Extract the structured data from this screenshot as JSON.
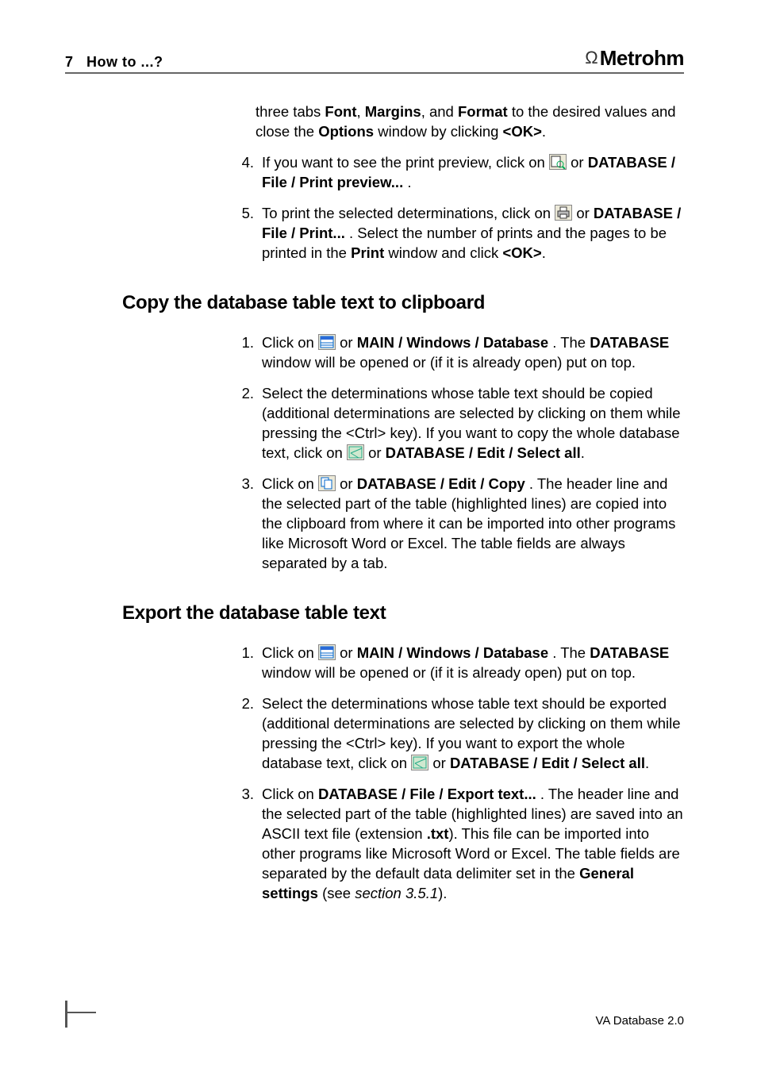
{
  "header": {
    "chapter_num": "7",
    "chapter_title": "How to ...?",
    "brand": "Metrohm"
  },
  "footer": {
    "product": "VA Database 2.0"
  },
  "block_prev": {
    "step3_tail_a": "three tabs ",
    "step3_tail_b": "Font",
    "step3_tail_c": ", ",
    "step3_tail_d": "Margins",
    "step3_tail_e": ", and ",
    "step3_tail_f": "Format",
    "step3_tail_g": " to the desired values and close the ",
    "step3_tail_h": "Options",
    "step3_tail_i": " window by clicking ",
    "step3_tail_j": "<OK>",
    "step3_tail_k": ".",
    "step4_num": "4.",
    "step4_a": "If you want to see the print preview, click on ",
    "step4_b": " or ",
    "step4_c": "DATABASE",
    "step4_d": " / ",
    "step4_e": "File",
    "step4_f": " / ",
    "step4_g": "Print preview...",
    "step4_h": " .",
    "step5_num": "5.",
    "step5_a": "To print the selected determinations, click on ",
    "step5_b": " or ",
    "step5_c": "DATABASE",
    "step5_d": " / ",
    "step5_e": "File",
    "step5_f": " / ",
    "step5_g": "Print...",
    "step5_h": " . Select the number of prints and the pages to be printed in the ",
    "step5_i": "Print",
    "step5_j": " window and click ",
    "step5_k": "<OK>",
    "step5_l": "."
  },
  "section_copy": {
    "title": "Copy the database table text to clipboard",
    "s1_num": "1.",
    "s1_a": "Click on ",
    "s1_b": " or ",
    "s1_c": "MAIN",
    "s1_d": " / ",
    "s1_e": "Windows",
    "s1_f": " / ",
    "s1_g": "Database",
    "s1_h": " . The ",
    "s1_i": "DATABASE",
    "s1_j": " window will be opened or (if it is already open) put on top.",
    "s2_num": "2.",
    "s2_a": "Select the determinations whose table text should be copied (additional determinations are selected by clicking on them while pressing the <Ctrl> key). If you want to copy the whole database text, click on ",
    "s2_b": " or ",
    "s2_c": "DATABASE",
    "s2_d": " / ",
    "s2_e": "Edit",
    "s2_f": " / ",
    "s2_g": "Select all",
    "s2_h": ".",
    "s3_num": "3.",
    "s3_a": "Click on ",
    "s3_b": " or ",
    "s3_c": "DATABASE",
    "s3_d": " / ",
    "s3_e": "Edit",
    "s3_f": " / ",
    "s3_g": "Copy",
    "s3_h": " . The header line and the selected part of the table (highlighted lines) are copied into the clipboard from where it can be imported into other programs like Microsoft Word or Excel. The table fields are always separated by a tab."
  },
  "section_export": {
    "title": "Export the database table text",
    "s1_num": "1.",
    "s1_a": "Click on ",
    "s1_b": " or ",
    "s1_c": "MAIN",
    "s1_d": " / ",
    "s1_e": "Windows",
    "s1_f": " / ",
    "s1_g": "Database",
    "s1_h": " . The ",
    "s1_i": "DATABASE",
    "s1_j": " window will be opened or (if it is already open) put on top.",
    "s2_num": "2.",
    "s2_a": "Select the determinations whose table text should be exported (additional determinations are selected by clicking on them while pressing the <Ctrl> key). If you want to export the whole database text, click on ",
    "s2_b": " or ",
    "s2_c": "DATABASE",
    "s2_d": " / ",
    "s2_e": "Edit",
    "s2_f": " / ",
    "s2_g": "Select all",
    "s2_h": ".",
    "s3_num": "3.",
    "s3_a": "Click on ",
    "s3_b": "DATABASE",
    "s3_c": " / ",
    "s3_d": "File",
    "s3_e": " / ",
    "s3_f": "Export text...",
    "s3_g": " . The header line and the selected part of the table (highlighted lines) are saved into an ASCII text file (extension ",
    "s3_h": ".txt",
    "s3_i": "). This file can be imported into other programs like Microsoft Word or Excel. The table fields are separated by the default data delimiter set in the ",
    "s3_j": "General settings",
    "s3_k": " (see ",
    "s3_l": "section 3.5.1",
    "s3_m": ")."
  }
}
